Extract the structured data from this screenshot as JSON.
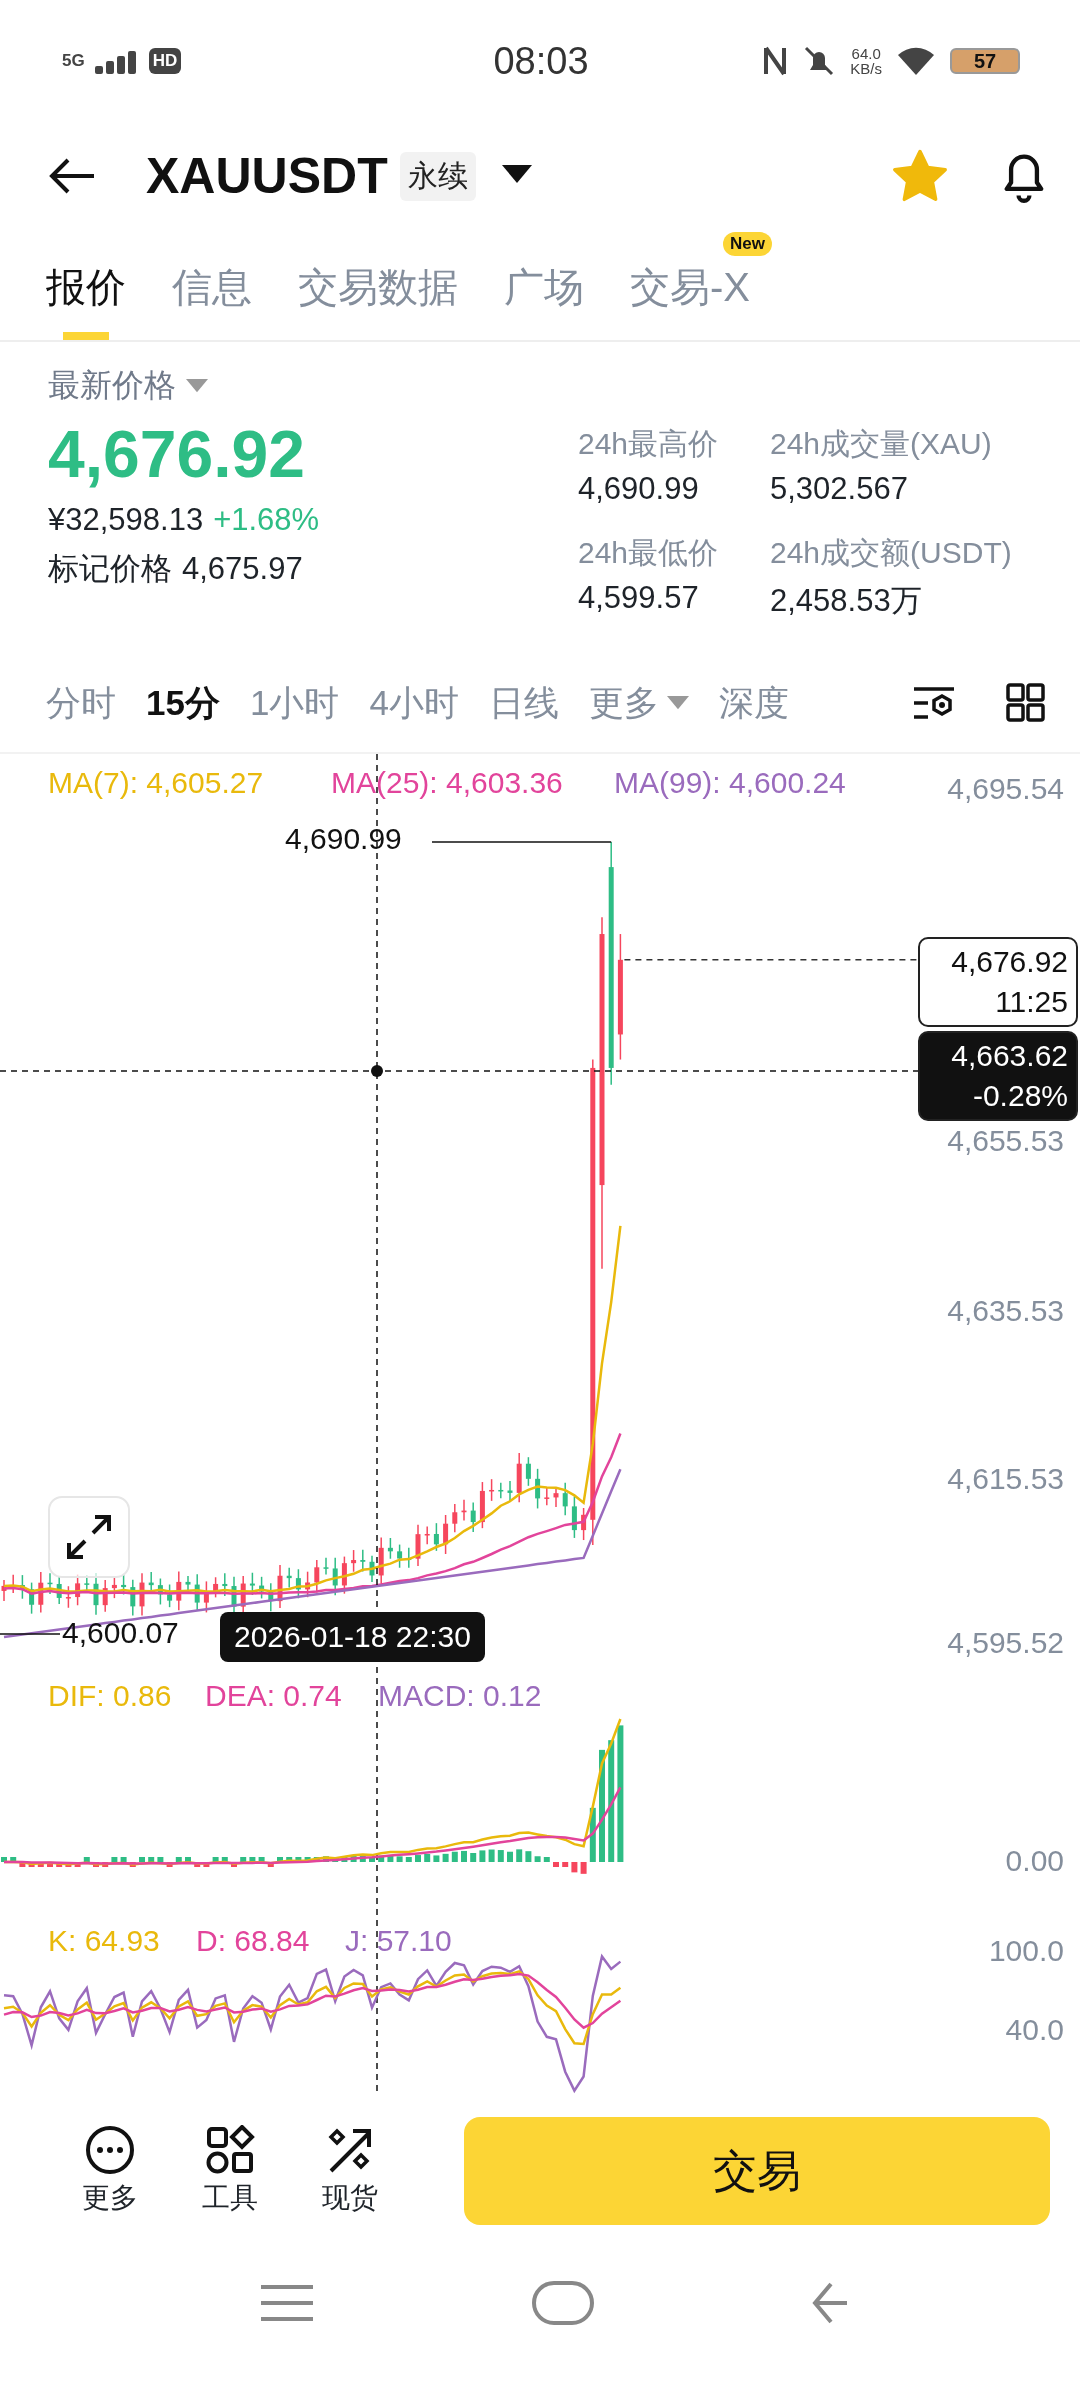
{
  "status_bar": {
    "network": "5G",
    "hd_badge": "HD",
    "time": "08:03",
    "speed": "64.0",
    "speed_unit": "KB/s",
    "battery": "57"
  },
  "header": {
    "symbol": "XAUUSDT",
    "contract_type": "永续",
    "favorite": true
  },
  "tabs": [
    {
      "label": "报价",
      "selected": true
    },
    {
      "label": "信息",
      "selected": false
    },
    {
      "label": "交易数据",
      "selected": false
    },
    {
      "label": "广场",
      "selected": false
    },
    {
      "label": "交易-X",
      "selected": false,
      "badge": "New"
    }
  ],
  "price": {
    "label": "最新价格",
    "last": "4,676.92",
    "cny": "¥32,598.13",
    "change": "+1.68%",
    "mark_label": "标记价格",
    "mark": "4,675.97"
  },
  "stats": [
    {
      "label": "24h最高价",
      "value": "4,690.99"
    },
    {
      "label": "24h成交量(XAU)",
      "value": "5,302.567"
    },
    {
      "label": "24h最低价",
      "value": "4,599.57"
    },
    {
      "label": "24h成交额(USDT)",
      "value": "2,458.53万"
    }
  ],
  "intervals": [
    {
      "label": "分时",
      "selected": false
    },
    {
      "label": "15分",
      "selected": true
    },
    {
      "label": "1小时",
      "selected": false
    },
    {
      "label": "4小时",
      "selected": false
    },
    {
      "label": "日线",
      "selected": false
    },
    {
      "label": "更多",
      "selected": false,
      "dropdown": true
    },
    {
      "label": "深度",
      "selected": false
    }
  ],
  "chart": {
    "ma_legend": [
      {
        "text": "MA(7): 4,605.27",
        "color": "#e9b90c"
      },
      {
        "text": "MA(25): 4,603.36",
        "color": "#e2449b"
      },
      {
        "text": "MA(99): 4,600.24",
        "color": "#9a6bbd"
      }
    ],
    "price_axis": [
      "4,695.54",
      "4,655.53",
      "4,635.53",
      "4,615.53",
      "4,595.52"
    ],
    "high_label": "4,690.99",
    "low_label": "4,600.07",
    "last_price": {
      "price": "4,676.92",
      "countdown": "11:25"
    },
    "crosshair": {
      "price": "4,663.62",
      "change": "-0.28%",
      "time": "2026-01-18 22:30"
    }
  },
  "macd": {
    "legend": [
      {
        "text": "DIF: 0.86",
        "color": "#e9b90c"
      },
      {
        "text": "DEA: 0.74",
        "color": "#e2449b"
      },
      {
        "text": "MACD: 0.12",
        "color": "#9a6bbd"
      }
    ],
    "axis": [
      "0.00"
    ]
  },
  "kdj": {
    "legend": [
      {
        "text": "K: 64.93",
        "color": "#e9b90c"
      },
      {
        "text": "D: 68.84",
        "color": "#e2449b"
      },
      {
        "text": "J: 57.10",
        "color": "#9a6bbd"
      }
    ],
    "axis": [
      "100.0",
      "40.0"
    ]
  },
  "bottom_bar": {
    "actions": [
      {
        "label": "更多",
        "kind": "more"
      },
      {
        "label": "工具",
        "kind": "tools"
      },
      {
        "label": "现货",
        "kind": "spot"
      }
    ],
    "trade_button": "交易"
  }
}
